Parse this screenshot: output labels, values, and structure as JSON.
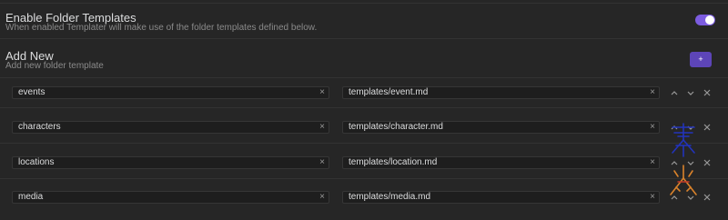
{
  "enable": {
    "title": "Enable Folder Templates",
    "description": "When enabled Templater will make use of the folder templates defined below.",
    "on": true
  },
  "add": {
    "title": "Add New",
    "description": "Add new folder template",
    "button_label": "+"
  },
  "clear_glyph": "×",
  "rows": [
    {
      "folder": "events",
      "template": "templates/event.md"
    },
    {
      "folder": "characters",
      "template": "templates/character.md"
    },
    {
      "folder": "locations",
      "template": "templates/location.md"
    },
    {
      "folder": "media",
      "template": "templates/media.md"
    }
  ],
  "colors": {
    "background": "#262626",
    "accent": "#7c5ce0",
    "button": "#5d45b8"
  }
}
